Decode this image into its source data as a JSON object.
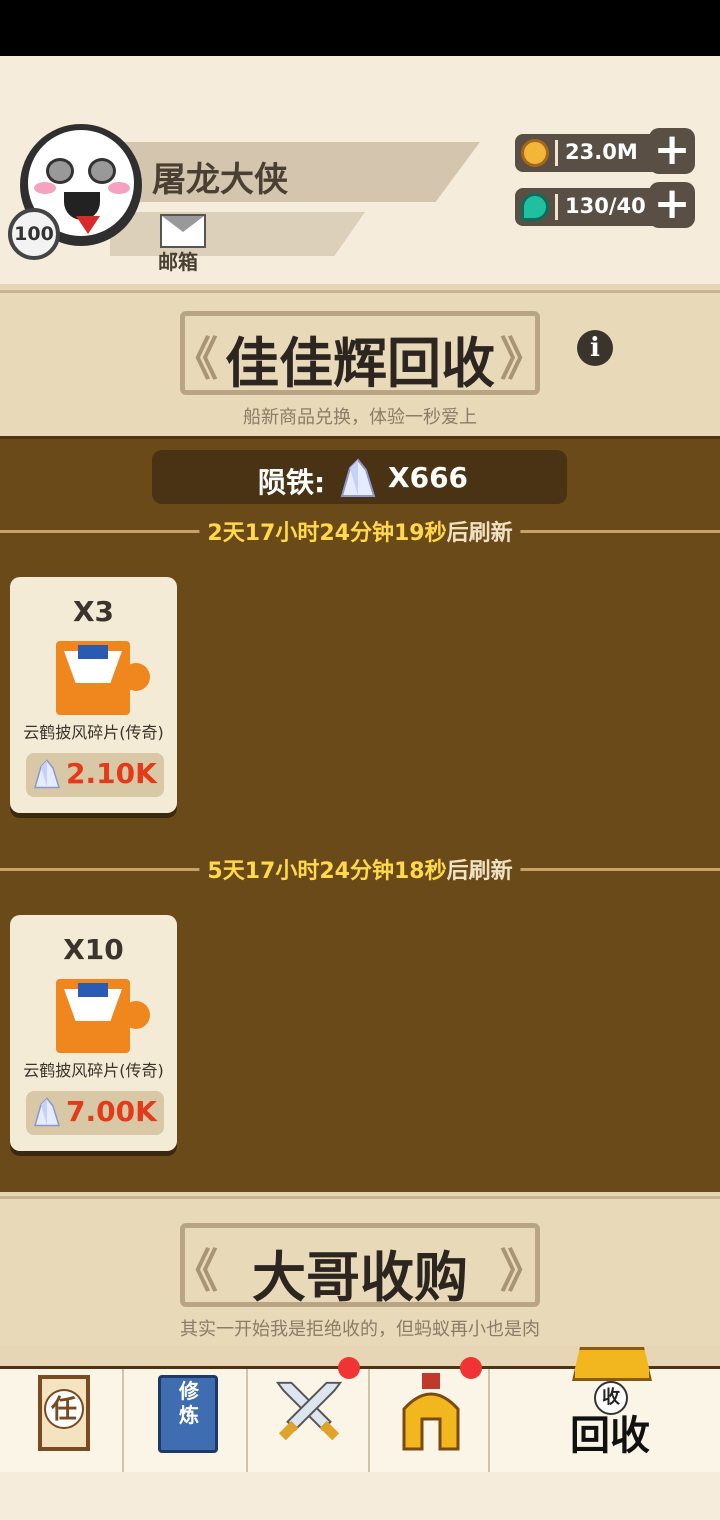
{
  "header": {
    "player_name": "屠龙大侠",
    "level": "100",
    "mail_label": "邮箱",
    "resources": [
      {
        "icon": "coin-icon",
        "value": "23.0M",
        "color": "#f3b63a"
      },
      {
        "icon": "energy-drop-icon",
        "value": "130/40",
        "color": "#1fbf9f"
      }
    ]
  },
  "recycle": {
    "title": "佳佳辉回收",
    "subtitle": "船新商品兑换，体验一秒爱上",
    "meteor_label": "陨铁:",
    "meteor_value": "X666",
    "groups": [
      {
        "timer": "2天17小时24分钟19秒",
        "timer_suffix": "后刷新",
        "item": {
          "qty": "X3",
          "name": "云鹤披风碎片(传奇)",
          "price": "2.10K"
        }
      },
      {
        "timer": "5天17小时24分钟18秒",
        "timer_suffix": "后刷新",
        "item": {
          "qty": "X10",
          "name": "云鹤披风碎片(传奇)",
          "price": "7.00K"
        }
      }
    ]
  },
  "buyback": {
    "title": "大哥收购",
    "subtitle": "其实一开始我是拒绝收的，但蚂蚁再小也是肉"
  },
  "nav": {
    "items": [
      {
        "label": "任",
        "icon": "task-scroll-icon"
      },
      {
        "label": "修炼",
        "icon": "cultivation-book-icon"
      },
      {
        "label": "",
        "icon": "crossed-swords-icon"
      },
      {
        "label": "",
        "icon": "helmet-icon"
      },
      {
        "label": "回收",
        "icon": "recycle-shop-icon",
        "badge": "收"
      }
    ]
  },
  "colors": {
    "accent_yellow": "#ffd94a",
    "price_red": "#e33b1a",
    "panel_brown": "#6b4a1a"
  }
}
